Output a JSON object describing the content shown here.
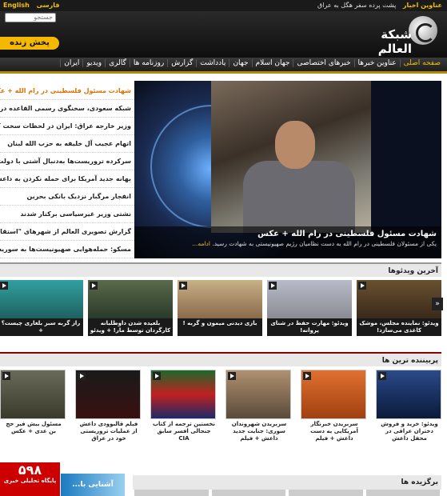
{
  "topbar": {
    "languages": [
      "English",
      "فارسی"
    ],
    "ticker_label": "عناوین اخبار",
    "ticker_text": "پشت پرده سفر هگل به عراق"
  },
  "header": {
    "search_placeholder": "جستجو",
    "live_label": "پخش زنده",
    "logo_text": "شبكة العالم"
  },
  "nav": {
    "items": [
      "صفحه اصلی",
      "عناوین خبرها",
      "خبرهای اختصاصی",
      "جهان اسلام",
      "جهان",
      "یادداشت",
      "گزارش",
      "روزنامه ها",
      "گالری",
      "ویدیو",
      "ایران"
    ]
  },
  "headlines": [
    "شهادت مسئول فلسطینی در رام الله + عکس",
    "شبکه سعودی، سخنگوی رسمی القاعده در یمن",
    "وزیر خارجه عراق: ایران در لحظات سخت کنار ما بود +",
    "اتهام عجیب آل خلیفه به حزب الله لبنان",
    "سرکرده تروریست‌ها به‌دنبال آشتی با دولت سوریه",
    "بهانه جدید آمریکا برای حمله نکردن به داعش!",
    "انفجار مرگبار نزدیک بانکی بحرین",
    "نشتی وزیر غیرسیاسی برکنار شدند",
    "گزارش تصویری العالم از شهرهای \"استقامت\"",
    "مسکو: حمله‌هوایی صهیونیست‌ها به سوریه را محکوم"
  ],
  "feature": {
    "title": "شهادت مسئول فلسطینی در رام الله + عکس",
    "summary": "یکی از مسئولان فلسطینی در رام الله به دست نظامیان رژیم صهیونیستی به شهادت رسید.",
    "more": "ادامه..."
  },
  "videos": {
    "title": "آخرین ویدئوها",
    "items": [
      "ویدئو: نماینده مجلس، موشک کاغذی می‌سازد!",
      "ویدئو: مهارت حفظ در شنای پروانه!",
      "بازی دیدنی میمون و گربه !",
      "بلعیده شدن داوطلبانه کارگردان توسط مار! + ویدئو",
      "راز گربه سبز بلغاری چیست؟ +"
    ]
  },
  "popular": {
    "title": "پربیننده ترین ها",
    "items": [
      "ویدئو: خرید و فروش دختران عراقی در محفل داعش",
      "سربریدن خبرنگار آمریکایی به دست داعش + فیلم",
      "سربریدن شهروندان سوری: جنایت جدید داعش + فیلم",
      "نخستین ترجمه از کتاب جنجالی افسر سابق CIA",
      "فیلم قالبوودی داعش از عملیات تروریستی خود در عراق",
      "مسئول بیش فیر حج بن عدی + عکس"
    ]
  },
  "favorites": {
    "title": "برگزیده ها"
  },
  "ads": {
    "ad1_big": "۵۹۸",
    "ad1_sub": "پایگاه تحلیلی خبری",
    "ad2": "آشنایی با..."
  }
}
